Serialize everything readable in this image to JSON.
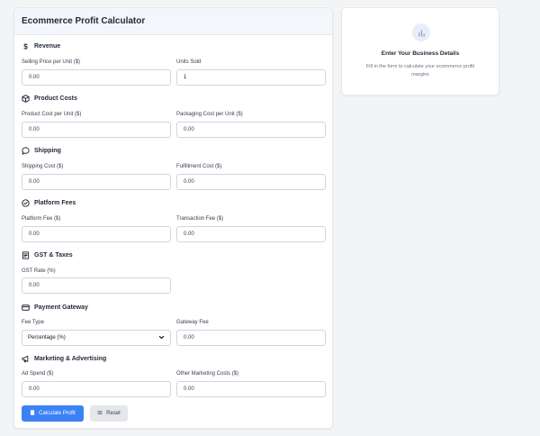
{
  "calculator": {
    "title": "Ecommerce Profit Calculator",
    "revenue": {
      "title": "Revenue",
      "selling_price_label": "Selling Price per Unit ($)",
      "selling_price_value": "0.00",
      "units_sold_label": "Units Sold",
      "units_sold_value": "1"
    },
    "product_costs": {
      "title": "Product Costs",
      "product_cost_label": "Product Cost per Unit ($)",
      "product_cost_value": "0.00",
      "packaging_cost_label": "Packaging Cost per Unit ($)",
      "packaging_cost_value": "0.00"
    },
    "shipping": {
      "title": "Shipping",
      "shipping_cost_label": "Shipping Cost ($)",
      "shipping_cost_value": "0.00",
      "fulfillment_cost_label": "Fulfillment Cost ($)",
      "fulfillment_cost_value": "0.00"
    },
    "platform_fees": {
      "title": "Platform Fees",
      "platform_fee_label": "Platform Fee ($)",
      "platform_fee_value": "0.00",
      "transaction_fee_label": "Transaction Fee ($)",
      "transaction_fee_value": "0.00"
    },
    "gst_taxes": {
      "title": "GST & Taxes",
      "gst_rate_label": "GST Rate (%)",
      "gst_rate_value": "0.00"
    },
    "payment_gateway": {
      "title": "Payment Gateway",
      "fee_type_label": "Fee Type",
      "fee_type_selected": "Percentage (%)",
      "gateway_fee_label": "Gateway Fee",
      "gateway_fee_value": "0.00"
    },
    "marketing": {
      "title": "Marketing & Advertising",
      "ad_spend_label": "Ad Spend ($)",
      "ad_spend_value": "0.00",
      "other_marketing_label": "Other Marketing Costs ($)",
      "other_marketing_value": "0.00"
    },
    "buttons": {
      "calculate_label": "Calculate Profit",
      "reset_label": "Reset"
    }
  },
  "results_panel": {
    "title": "Enter Your Business Details",
    "text": "Fill in the form to calculate your ecommerce profit margins",
    "icon": "bar-chart-icon"
  },
  "colors": {
    "accent": "#3b82f6",
    "page_background": "#f3f4f6",
    "header_background": "#f3f6fa"
  }
}
